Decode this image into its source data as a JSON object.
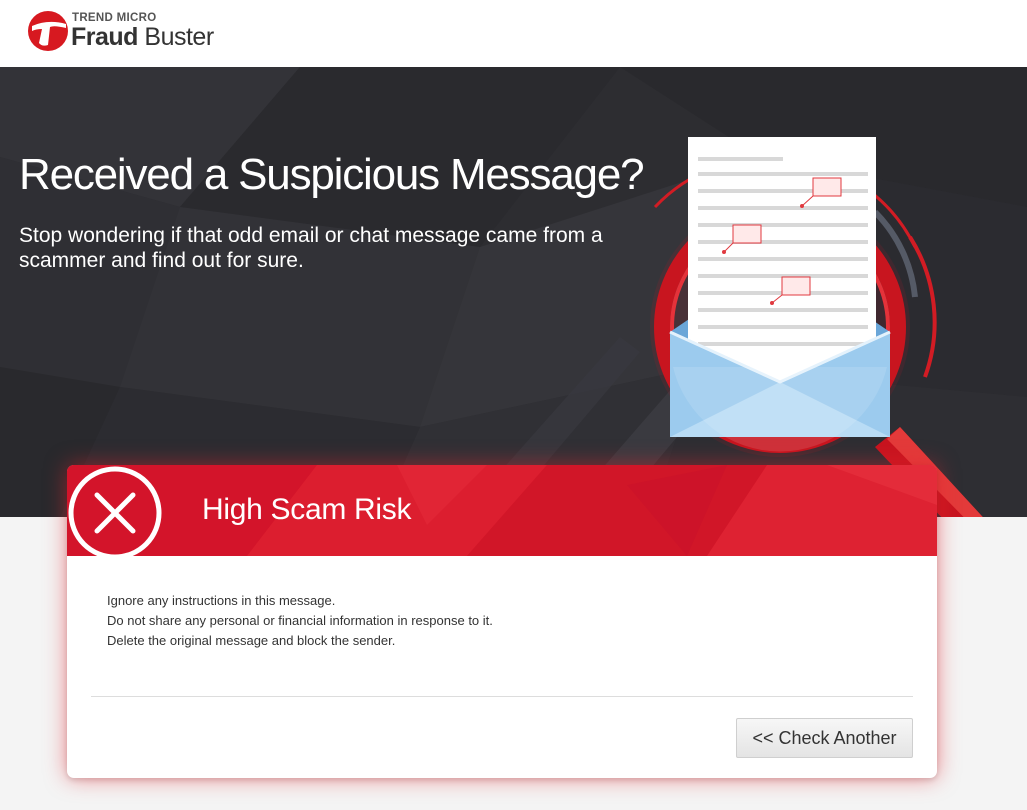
{
  "brand": {
    "company": "TREND MICRO",
    "product_bold": "Fraud",
    "product_rest": " Buster"
  },
  "hero": {
    "title": "Received a Suspicious Message?",
    "subtitle": "Stop wondering if that odd email or chat message came from a scammer and find out for sure."
  },
  "result": {
    "title": "High Scam Risk",
    "advice": [
      "Ignore any instructions in this message.",
      "Do not share any personal or financial information in response to it.",
      "Delete the original message and block the sender."
    ],
    "button_label": "<< Check Another"
  },
  "colors": {
    "brand_red": "#d8172b",
    "hero_dark": "#2d2d31",
    "page_bg": "#f4f4f4"
  },
  "icons": [
    "trend-micro-logo-icon",
    "magnifier-envelope-illustration",
    "x-circle-icon"
  ]
}
